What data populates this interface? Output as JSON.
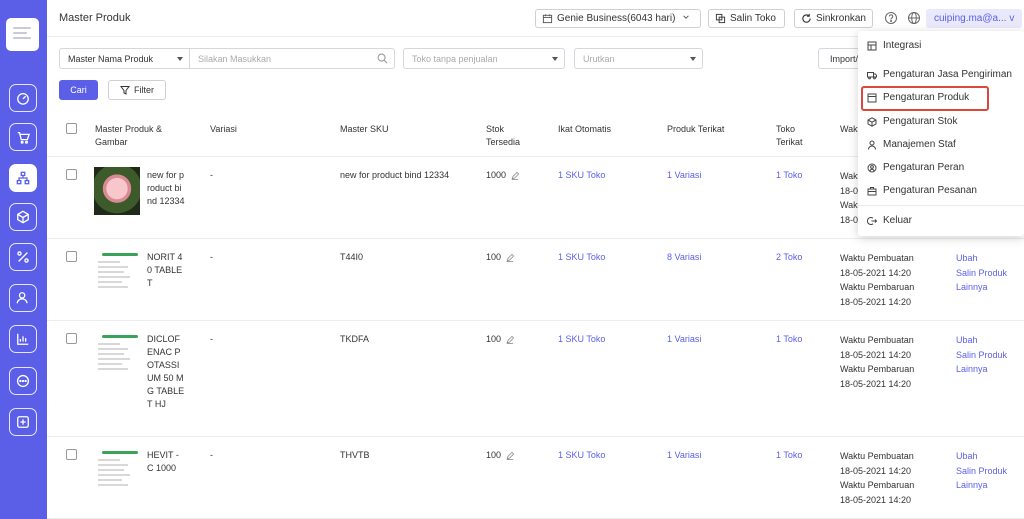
{
  "header": {
    "title": "Master Produk",
    "plan": "Genie Business(6043 hari)",
    "copy_store": "Salin Toko",
    "sync": "Sinkronkan",
    "user": "cuiping.ma@a...",
    "user_caret": "v"
  },
  "filters": {
    "field_select": "Master Nama Produk",
    "search_placeholder": "Silakan Masukkan",
    "store_placeholder": "Toko tanpa penjualan",
    "sort_placeholder": "Urutkan",
    "import_label": "Import/",
    "search_button": "Cari",
    "filter_button": "Filter"
  },
  "table": {
    "headers": {
      "product": "Master Produk & Gambar",
      "variation": "Variasi",
      "sku": "Master SKU",
      "stock": "Stok Tersedia",
      "auto_bind": "Ikat Otomatis",
      "linked_products": "Produk Terikat",
      "linked_stores": "Toko Terikat",
      "time": "Waktu"
    },
    "rows": [
      {
        "name": "new for product bind 12334",
        "variation": "-",
        "sku": "new for product bind 12334",
        "stock": "1000",
        "auto_bind": "1 SKU Toko",
        "linked_products": "1 Variasi",
        "linked_stores": "1 Toko",
        "created_label": "Wakt",
        "created": "18-0",
        "updated_label": "Wakt",
        "updated": "18-0",
        "actions": [
          "",
          "",
          ""
        ]
      },
      {
        "name": "NORIT 40 TABLET",
        "variation": "-",
        "sku": "T44I0",
        "stock": "100",
        "auto_bind": "1 SKU Toko",
        "linked_products": "8 Variasi",
        "linked_stores": "2 Toko",
        "created_label": "Waktu Pembuatan",
        "created": "18-05-2021 14:20",
        "updated_label": "Waktu Pembaruan",
        "updated": "18-05-2021 14:20",
        "actions": [
          "Ubah",
          "Salin Produk",
          "Lainnya"
        ]
      },
      {
        "name": "DICLOFENAC POTASSIUM 50 MG TABLET HJ",
        "variation": "-",
        "sku": "TKDFA",
        "stock": "100",
        "auto_bind": "1 SKU Toko",
        "linked_products": "1 Variasi",
        "linked_stores": "1 Toko",
        "created_label": "Waktu Pembuatan",
        "created": "18-05-2021 14:20",
        "updated_label": "Waktu Pembaruan",
        "updated": "18-05-2021 14:20",
        "actions": [
          "Ubah",
          "Salin Produk",
          "Lainnya"
        ]
      },
      {
        "name": "HEVIT - C 1000",
        "variation": "-",
        "sku": "THVTB",
        "stock": "100",
        "auto_bind": "1 SKU Toko",
        "linked_products": "1 Variasi",
        "linked_stores": "1 Toko",
        "created_label": "Waktu Pembuatan",
        "created": "18-05-2021 14:20",
        "updated_label": "Waktu Pembaruan",
        "updated": "18-05-2021 14:20",
        "actions": [
          "Ubah",
          "Salin Produk",
          "Lainnya"
        ]
      }
    ]
  },
  "menu": {
    "items": [
      {
        "label": "Integrasi",
        "icon": "integration-icon"
      },
      {
        "label": "Pengaturan Jasa Pengiriman",
        "icon": "truck-icon"
      },
      {
        "label": "Pengaturan Produk",
        "icon": "product-settings-icon"
      },
      {
        "label": "Pengaturan Stok",
        "icon": "box-icon"
      },
      {
        "label": "Manajemen Staf",
        "icon": "staff-icon"
      },
      {
        "label": "Pengaturan Peran",
        "icon": "role-icon"
      },
      {
        "label": "Pengaturan Pesanan",
        "icon": "order-icon"
      },
      {
        "label": "Keluar",
        "icon": "logout-icon"
      }
    ]
  },
  "colors": {
    "accent": "#5b5fe8",
    "highlight_border": "#d9483b"
  }
}
